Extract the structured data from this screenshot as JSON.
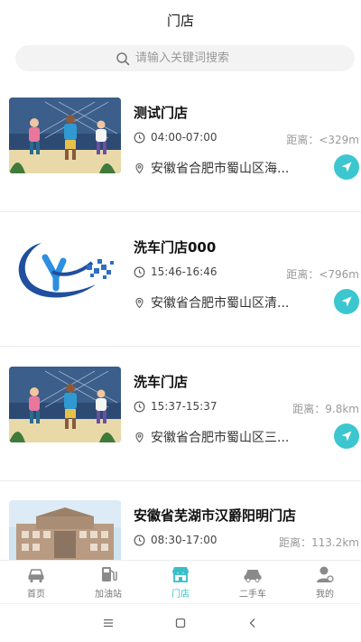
{
  "header": {
    "title": "门店"
  },
  "search": {
    "placeholder": "请输入关键词搜索"
  },
  "distance_prefix": "距离：",
  "stores": [
    {
      "name": "测试门店",
      "hours": "04:00-07:00",
      "distance": "距离：<329m",
      "address": "安徽省合肥市蜀山区海...",
      "image": "illustration-photo"
    },
    {
      "name": "洗车门店000",
      "hours": "15:46-16:46",
      "distance": "距离：<796m",
      "address": "安徽省合肥市蜀山区清...",
      "image": "brand-logo"
    },
    {
      "name": "洗车门店",
      "hours": "15:37-15:37",
      "distance": "距离：9.8km",
      "address": "安徽省合肥市蜀山区三...",
      "image": "illustration-photo"
    },
    {
      "name": "安徽省芜湖市汉爵阳明门店",
      "hours": "08:30-17:00",
      "distance": "距离：113.2km",
      "address": "",
      "image": "building-photo"
    }
  ],
  "tabbar": {
    "items": [
      {
        "label": "首页",
        "icon": "car-home-icon",
        "active": false
      },
      {
        "label": "加油站",
        "icon": "fuel-pump-icon",
        "active": false
      },
      {
        "label": "门店",
        "icon": "store-icon",
        "active": true
      },
      {
        "label": "二手车",
        "icon": "used-car-icon",
        "active": false
      },
      {
        "label": "我的",
        "icon": "profile-icon",
        "active": false
      }
    ]
  },
  "colors": {
    "accent": "#3cc6cf",
    "tab_active": "#35bfc9",
    "muted": "#9a9a9a"
  }
}
